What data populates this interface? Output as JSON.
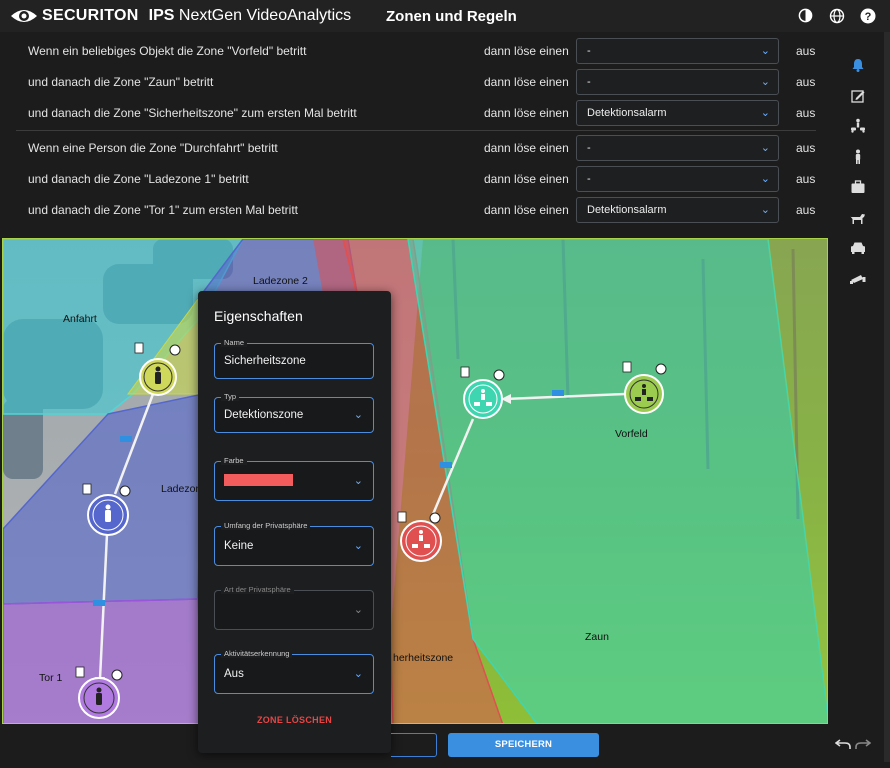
{
  "header": {
    "brand": "SECURITON",
    "product_bold": "IPS",
    "product_rest": " NextGen VideoAnalytics",
    "page_title": "Zonen und Regeln",
    "icons": [
      "contrast-icon",
      "globe-icon",
      "help-icon"
    ]
  },
  "rules": [
    {
      "text": "Wenn ein beliebiges Objekt die Zone \"Vorfeld\" betritt",
      "then": "dann löse einen",
      "action": "-",
      "state": "aus"
    },
    {
      "text": "und danach die Zone \"Zaun\" betritt",
      "then": "dann löse einen",
      "action": "-",
      "state": "aus"
    },
    {
      "text": "und danach die Zone \"Sicherheitszone\" zum ersten Mal betritt",
      "then": "dann löse einen",
      "action": "Detektionsalarm",
      "state": "aus"
    },
    {
      "text": "Wenn eine Person die Zone \"Durchfahrt\" betritt",
      "then": "dann löse einen",
      "action": "-",
      "state": "aus"
    },
    {
      "text": "und danach die Zone \"Ladezone 1\" betritt",
      "then": "dann löse einen",
      "action": "-",
      "state": "aus"
    },
    {
      "text": "und danach die Zone \"Tor 1\" zum ersten Mal betritt",
      "then": "dann löse einen",
      "action": "Detektionsalarm",
      "state": "aus"
    }
  ],
  "sidebar": [
    "bell-icon",
    "edit-icon",
    "person-vehicle-icon",
    "person-icon",
    "luggage-icon",
    "dog-icon",
    "car-icon",
    "camera-icon"
  ],
  "zones": {
    "anfahrt": "Anfahrt",
    "ladezone2": "Ladezone 2",
    "ladezone1": "Ladezone",
    "tor1": "Tor 1",
    "vorfeld": "Vorfeld",
    "zaun": "Zaun",
    "sicherheitszone": "herheitszone"
  },
  "panel": {
    "title": "Eigenschaften",
    "name_label": "Name",
    "name_value": "Sicherheitszone",
    "type_label": "Typ",
    "type_value": "Detektionszone",
    "color_label": "Farbe",
    "color_value": "#f25c5c",
    "privacy_scope_label": "Umfang der Privatsphäre",
    "privacy_scope_value": "Keine",
    "privacy_type_label": "Art der Privatsphäre",
    "privacy_type_value": "",
    "activity_label": "Aktivitätserkennung",
    "activity_value": "Aus",
    "delete_label": "ZONE LÖSCHEN"
  },
  "footer": {
    "save_label": "SPEICHERN"
  },
  "colors": {
    "accent": "#3b8fe0",
    "danger": "#e84545",
    "zone_vorfeld": "#9ccc4f",
    "zone_zaun": "#3ed6b0",
    "zone_sicherheit": "#e05050",
    "zone_ladezone": "#5566cc",
    "zone_tor": "#9a55d8",
    "zone_anfahrt": "#4fd6d6"
  }
}
